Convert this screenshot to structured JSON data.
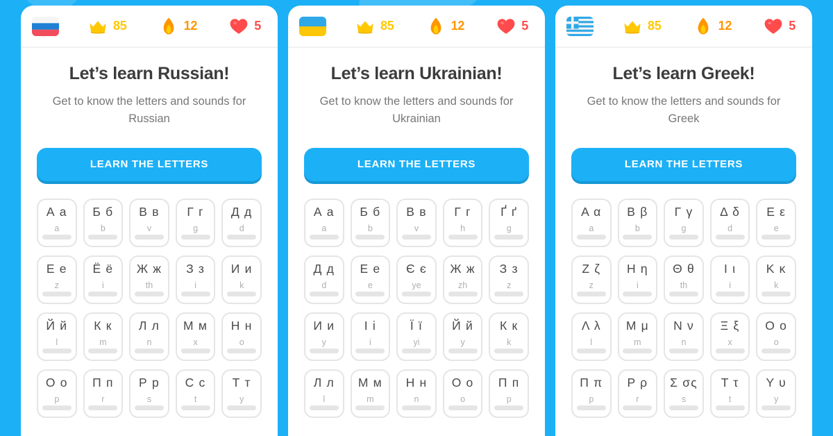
{
  "theme": {
    "background": "#1cb0f6",
    "card_background": "#ffffff",
    "button_color": "#1cb0f6",
    "button_shadow": "#1899d6",
    "title_color": "#3c3c3c",
    "subtitle_color": "#777777",
    "crown_color": "#ffc800",
    "streak_color": "#ff9600",
    "hearts_color": "#ff4b4b",
    "tile_border": "#e5e5e5",
    "tile_bar_color": "#e5e5e5",
    "translit_color": "#afafaf"
  },
  "panels": [
    {
      "flag_icon": "flag-russia-icon",
      "flag_name": "Russian flag",
      "stats": {
        "crown_icon": "crown-icon",
        "crown_value": "85",
        "streak_icon": "flame-icon",
        "streak_value": "12",
        "hearts_icon": "heart-icon",
        "hearts_value": "5"
      },
      "title": "Let’s learn Russian!",
      "subtitle": "Get to know the letters and sounds for Russian",
      "cta_label": "LEARN THE LETTERS",
      "letters": [
        {
          "letters": "А а",
          "translit": "a"
        },
        {
          "letters": "Б б",
          "translit": "b"
        },
        {
          "letters": "В в",
          "translit": "v"
        },
        {
          "letters": "Г г",
          "translit": "g"
        },
        {
          "letters": "Д д",
          "translit": "d"
        },
        {
          "letters": "Е е",
          "translit": "z"
        },
        {
          "letters": "Ё ё",
          "translit": "i"
        },
        {
          "letters": "Ж ж",
          "translit": "th"
        },
        {
          "letters": "З з",
          "translit": "i"
        },
        {
          "letters": "И и",
          "translit": "k"
        },
        {
          "letters": "Й й",
          "translit": "l"
        },
        {
          "letters": "К к",
          "translit": "m"
        },
        {
          "letters": "Л л",
          "translit": "n"
        },
        {
          "letters": "М м",
          "translit": "x"
        },
        {
          "letters": "Н н",
          "translit": "o"
        },
        {
          "letters": "О о",
          "translit": "p"
        },
        {
          "letters": "П п",
          "translit": "r"
        },
        {
          "letters": "Р р",
          "translit": "s"
        },
        {
          "letters": "С с",
          "translit": "t"
        },
        {
          "letters": "Т т",
          "translit": "y"
        }
      ]
    },
    {
      "flag_icon": "flag-ukraine-icon",
      "flag_name": "Ukrainian flag",
      "stats": {
        "crown_icon": "crown-icon",
        "crown_value": "85",
        "streak_icon": "flame-icon",
        "streak_value": "12",
        "hearts_icon": "heart-icon",
        "hearts_value": "5"
      },
      "title": "Let’s learn Ukrainian!",
      "subtitle": "Get to know the letters and sounds for Ukrainian",
      "cta_label": "LEARN THE LETTERS",
      "letters": [
        {
          "letters": "А а",
          "translit": "a"
        },
        {
          "letters": "Б б",
          "translit": "b"
        },
        {
          "letters": "В в",
          "translit": "v"
        },
        {
          "letters": "Г г",
          "translit": "h"
        },
        {
          "letters": "Ґ ґ",
          "translit": "g"
        },
        {
          "letters": "Д д",
          "translit": "d"
        },
        {
          "letters": "Е е",
          "translit": "e"
        },
        {
          "letters": "Є є",
          "translit": "ye"
        },
        {
          "letters": "Ж ж",
          "translit": "zh"
        },
        {
          "letters": "З з",
          "translit": "z"
        },
        {
          "letters": "И и",
          "translit": "y"
        },
        {
          "letters": "І і",
          "translit": "i"
        },
        {
          "letters": "Ї ї",
          "translit": "yi"
        },
        {
          "letters": "Й й",
          "translit": "y"
        },
        {
          "letters": "К к",
          "translit": "k"
        },
        {
          "letters": "Л л",
          "translit": "l"
        },
        {
          "letters": "М м",
          "translit": "m"
        },
        {
          "letters": "Н н",
          "translit": "n"
        },
        {
          "letters": "О о",
          "translit": "o"
        },
        {
          "letters": "П п",
          "translit": "p"
        }
      ]
    },
    {
      "flag_icon": "flag-greece-icon",
      "flag_name": "Greek flag",
      "stats": {
        "crown_icon": "crown-icon",
        "crown_value": "85",
        "streak_icon": "flame-icon",
        "streak_value": "12",
        "hearts_icon": "heart-icon",
        "hearts_value": "5"
      },
      "title": "Let’s learn Greek!",
      "subtitle": "Get to know the letters and sounds for Greek",
      "cta_label": "LEARN THE LETTERS",
      "letters": [
        {
          "letters": "Α α",
          "translit": "a"
        },
        {
          "letters": "Β β",
          "translit": "b"
        },
        {
          "letters": "Γ γ",
          "translit": "g"
        },
        {
          "letters": "Δ δ",
          "translit": "d"
        },
        {
          "letters": "Ε ε",
          "translit": "e"
        },
        {
          "letters": "Ζ ζ",
          "translit": "z"
        },
        {
          "letters": "Η η",
          "translit": "i"
        },
        {
          "letters": "Θ θ",
          "translit": "th"
        },
        {
          "letters": "Ι ι",
          "translit": "i"
        },
        {
          "letters": "Κ κ",
          "translit": "k"
        },
        {
          "letters": "Λ λ",
          "translit": "l"
        },
        {
          "letters": "Μ μ",
          "translit": "m"
        },
        {
          "letters": "Ν ν",
          "translit": "n"
        },
        {
          "letters": "Ξ ξ",
          "translit": "x"
        },
        {
          "letters": "Ο ο",
          "translit": "o"
        },
        {
          "letters": "Π π",
          "translit": "p"
        },
        {
          "letters": "Ρ ρ",
          "translit": "r"
        },
        {
          "letters": "Σ σς",
          "translit": "s"
        },
        {
          "letters": "Τ τ",
          "translit": "t"
        },
        {
          "letters": "Υ υ",
          "translit": "y"
        }
      ]
    }
  ]
}
